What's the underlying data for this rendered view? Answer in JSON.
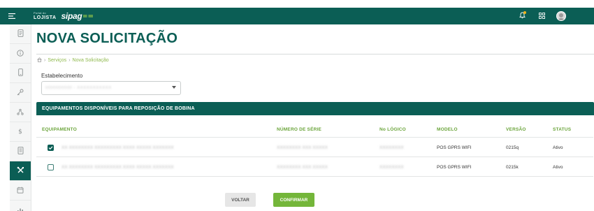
{
  "topbar": {
    "brand_portal": "Portal do",
    "brand_lojista": "LOJISTA",
    "brand_logo": "sipag"
  },
  "sidebar": {
    "items": [
      {
        "icon": "receipt-icon",
        "active": false
      },
      {
        "icon": "info-icon",
        "active": false
      },
      {
        "icon": "mobile-icon",
        "active": false
      },
      {
        "icon": "key-icon",
        "active": false
      },
      {
        "icon": "graph-icon",
        "active": false
      },
      {
        "icon": "dollar-icon",
        "active": false
      },
      {
        "icon": "document-icon",
        "active": false
      },
      {
        "icon": "tools-icon",
        "active": true
      },
      {
        "icon": "calendar-icon",
        "active": false
      },
      {
        "icon": "chart-icon",
        "active": false
      }
    ]
  },
  "page": {
    "title": "NOVA SOLICITAÇÃO"
  },
  "breadcrumb": {
    "home_icon": "home-icon",
    "link": "Serviços",
    "current": "Nova Solicitação"
  },
  "form": {
    "establishment_label": "Estabelecimento",
    "establishment_value": "0000000000 - XXXXXXXXXXX"
  },
  "section": {
    "title": "EQUIPAMENTOS DISPONÍVEIS PARA REPOSIÇÃO DE BOBINA"
  },
  "table": {
    "headers": [
      "EQUIPAMENTO",
      "NÚMERO DE SÉRIE",
      "No LÓGICO",
      "MODELO",
      "VERSÃO",
      "STATUS"
    ],
    "rows": [
      {
        "checked": true,
        "equipment": "XX XXXXXXXX XXXXXXXXX XXXX XXXXX XXXXXXX",
        "serial": "XXXXXXXX XXX XXXXX",
        "logical": "XXXXXXXX",
        "model": "POS GPRS WIFI",
        "version": "0215q",
        "status": "Ativo"
      },
      {
        "checked": false,
        "equipment": "XX XXXXXXXX XXXXXXXXX XXXX XXXXX XXXXXXX",
        "serial": "XXXXXXXX XXX XXXXX",
        "logical": "XXXXXXXX",
        "model": "POS GPRS WIFI",
        "version": "0215k",
        "status": "Ativo"
      }
    ]
  },
  "buttons": {
    "back": "VOLTAR",
    "confirm": "CONFIRMAR"
  },
  "colors": {
    "primary": "#0b5e55",
    "accent": "#74b63a",
    "header_text": "#6aa43a"
  }
}
